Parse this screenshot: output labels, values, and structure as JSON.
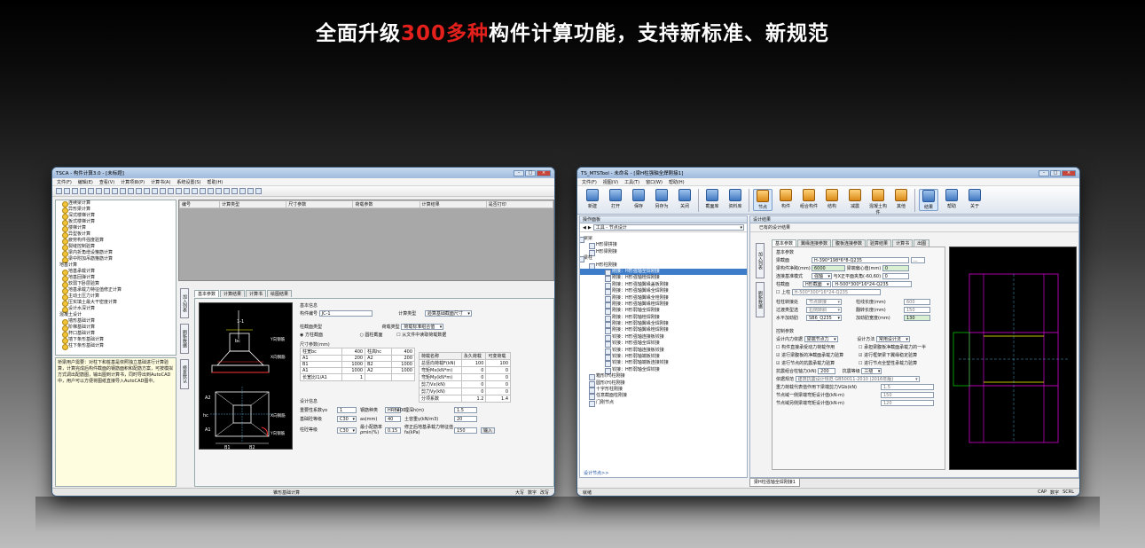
{
  "hero": {
    "pre": "全面升级",
    "highlight": "300多种",
    "post": "构件计算功能，支持新标准、新规范"
  },
  "colors": {
    "highlight": "#e3201b",
    "accent": "#3f77c0"
  },
  "left_window": {
    "title": "TSCA - 构件计算3.0 - [未标题]",
    "window_buttons": [
      "-",
      "□",
      "×"
    ],
    "menu": [
      "文件(F)",
      "编辑(E)",
      "查看(V)",
      "计算项目(P)",
      "计算书(A)",
      "系统设置(S)",
      "帮助(H)"
    ],
    "tree": [
      {
        "text": "连续梁计算",
        "group": false
      },
      {
        "text": "异形梁计算",
        "group": false
      },
      {
        "text": "深式楼梯计算",
        "group": false
      },
      {
        "text": "板式楼梯计算",
        "group": false
      },
      {
        "text": "楼梯计算",
        "group": false
      },
      {
        "text": "异型板计算",
        "group": false
      },
      {
        "text": "疲劳构件强度验算",
        "group": false
      },
      {
        "text": "裂缝控制验算",
        "group": false
      },
      {
        "text": "梁内折角增设箍筋计算",
        "group": false
      },
      {
        "text": "梁中附加吊筋箍筋计算",
        "group": false
      },
      {
        "text": "地基计算",
        "group": true
      },
      {
        "text": "地基承载计算",
        "group": false
      },
      {
        "text": "地基回弹计算",
        "group": false
      },
      {
        "text": "软弱下卧层验算",
        "group": false
      },
      {
        "text": "地基承载力特征值修正计算",
        "group": false
      },
      {
        "text": "主动土压力计算",
        "group": false
      },
      {
        "text": "压实填土最大干密度计算",
        "group": false
      },
      {
        "text": "设计水深计算",
        "group": false
      },
      {
        "text": "混凝土设计",
        "group": true
      },
      {
        "text": "墙形基础计算",
        "group": false
      },
      {
        "text": "阶梯基础计算",
        "group": false
      },
      {
        "text": "杯口基础计算",
        "group": false
      },
      {
        "text": "墙下条形基础计算",
        "group": false
      },
      {
        "text": "柱下条形基础计算",
        "group": false
      }
    ],
    "help_text": "桥梁用户需要：对柱下和桩基是依照独立基础进行计算验算，计算完成后构件截面的钢筋面积和配筋方案，可按模拟方式调出配筋图，输出图到计算书，同时导出到AutoCAD中，用户可以方便将图纸直接导入AutoCAD图中。",
    "result_columns": [
      "编号",
      "计算类型",
      "尺寸参数",
      "荷载参数",
      "计算结果",
      "是否打印"
    ],
    "side_tabs": [
      "加入列表",
      "刷新数据",
      "修复默认"
    ],
    "tabs": [
      "基本参数",
      "计算结果",
      "计算书",
      "绘图结果"
    ],
    "cad_labels": [
      "Y向钢筋",
      "X向钢筋",
      "X向钢筋",
      "Y向钢筋",
      "bc",
      "hc",
      "B1",
      "B2",
      "A1",
      "A2",
      "1-1"
    ],
    "basic_info": {
      "section": "基本信息",
      "id_label": "构件编号",
      "id_value": "JC-1",
      "type_label": "计算类型",
      "type_value": "验算基础截面尺寸"
    },
    "column_type": {
      "label": "柱截面类型",
      "opt1": "方柱截面",
      "opt2": "圆柱截面"
    },
    "load_type": {
      "label": "荷载类型",
      "value": "荷载标准组合值",
      "checkbox": "从文件中读取荷载数据"
    },
    "dim_table": {
      "title": "尺寸参数(mm)",
      "rows": [
        [
          "柱宽bc",
          "400",
          "柱高hc",
          "400"
        ],
        [
          "A1",
          "200",
          "A2",
          "200"
        ],
        [
          "B1",
          "1000",
          "B2",
          "1000"
        ],
        [
          "A1",
          "1000",
          "A2",
          "1000"
        ],
        [
          "长宽比l1/A1",
          "1",
          "",
          ""
        ]
      ]
    },
    "load_table": {
      "headers": [
        "荷载名称",
        "永久荷载",
        "可变荷载"
      ],
      "rows": [
        [
          "总竖向荷载F(kN)",
          "100",
          "100"
        ],
        [
          "弯矩Mx(kN*m)",
          "0",
          "0"
        ],
        [
          "弯矩My(kN*m)",
          "0",
          "0"
        ],
        [
          "剪力Vx(kN)",
          "0",
          "0"
        ],
        [
          "剪力Vy(kN)",
          "0",
          "0"
        ],
        [
          "分项系数",
          "1.2",
          "1.4"
        ]
      ]
    },
    "design": {
      "title": "设计信息",
      "rows": [
        [
          "重要性系数γo",
          "1",
          "钢筋种类",
          "HRB300",
          "埋深h(m)",
          "1.5"
        ],
        [
          "基础砼等级",
          "C30",
          "as(mm)",
          "40",
          "土容重γ(kN/m3)",
          "20"
        ],
        [
          "柱砼等级",
          "C30",
          "最小配筋率ρmin(%)",
          "0.15",
          "修正后地基承载力特征值fa(kPa)",
          "150"
        ]
      ],
      "button": "输入"
    },
    "status": {
      "center": "锥形基础计算",
      "right": [
        "大写",
        "数字",
        "改写"
      ]
    }
  },
  "right_window": {
    "title": "TS_MTSTool - 未命名 - [梁H柱强轴全焊刚接1]",
    "window_buttons": [
      "-",
      "□",
      "×"
    ],
    "menu": [
      "文件(F)",
      "视图(V)",
      "工具(T)",
      "窗口(W)",
      "帮助(H)"
    ],
    "ribbon": [
      {
        "label": "新建",
        "active": false,
        "orange": false
      },
      {
        "label": "打开",
        "active": false,
        "orange": false
      },
      {
        "label": "保存",
        "active": false,
        "orange": false
      },
      {
        "label": "另存为",
        "active": false,
        "orange": false
      },
      {
        "label": "关闭",
        "active": false,
        "orange": false
      },
      {
        "label": "截面库",
        "active": false,
        "orange": false
      },
      {
        "label": "资料库",
        "active": false,
        "orange": false
      },
      {
        "label": "节点",
        "active": true,
        "orange": true
      },
      {
        "label": "构件",
        "active": false,
        "orange": true
      },
      {
        "label": "组合构件",
        "active": false,
        "orange": true
      },
      {
        "label": "结构",
        "active": false,
        "orange": true
      },
      {
        "label": "减震",
        "active": false,
        "orange": true
      },
      {
        "label": "混凝土构件",
        "active": false,
        "orange": true
      },
      {
        "label": "其他",
        "active": false,
        "orange": true
      },
      {
        "label": "结果",
        "active": true,
        "orange": false
      },
      {
        "label": "帮助",
        "active": false,
        "orange": false
      },
      {
        "label": "关于",
        "active": false,
        "orange": false
      }
    ],
    "nav_title": "操作面板",
    "nav_sub": "工具 - 节点设计",
    "tree": [
      {
        "text": "梁梁",
        "level": 0
      },
      {
        "text": "H形梁拼接",
        "level": 1
      },
      {
        "text": "H形梁刚接",
        "level": 1
      },
      {
        "text": "梁柱",
        "level": 0
      },
      {
        "text": "H形柱刚接",
        "level": 1
      },
      {
        "text": "刚接：H形强轴全焊刚接",
        "level": 2
      },
      {
        "text": "刚接：H形强轴栓焊刚接",
        "level": 2
      },
      {
        "text": "刚接：H形强轴翼缘盖板刚接",
        "level": 2
      },
      {
        "text": "刚接：H形强轴翼缘全焊刚接",
        "level": 2
      },
      {
        "text": "刚接：H形强轴翼缘全栓刚接",
        "level": 2
      },
      {
        "text": "刚接：H形强轴翼缘栓焊刚接",
        "level": 2
      },
      {
        "text": "刚接：H形弱轴全焊刚接",
        "level": 2
      },
      {
        "text": "刚接：H形弱轴栓焊刚接",
        "level": 2
      },
      {
        "text": "刚接：H形弱轴翼缘全焊刚接",
        "level": 2
      },
      {
        "text": "刚接：H形弱轴翼缘栓焊刚接",
        "level": 2
      },
      {
        "text": "铰接：H形强轴连接板铰接",
        "level": 2
      },
      {
        "text": "铰接：H形强轴全焊铰接",
        "level": 2
      },
      {
        "text": "铰接：H形弱轴连接板铰接",
        "level": 2
      },
      {
        "text": "铰接：H形弱轴端板铰接",
        "level": 2
      },
      {
        "text": "铰接：H形弱轴端板连接铰接",
        "level": 2
      },
      {
        "text": "铰接：H形弱轴全焊铰接",
        "level": 2
      },
      {
        "text": "箱形(H)柱刚接",
        "level": 1
      },
      {
        "text": "圆形(H)柱刚接",
        "level": 1
      },
      {
        "text": "十字形柱刚接",
        "level": 1
      },
      {
        "text": "任意截面柱刚接",
        "level": 1
      },
      {
        "text": "门刚节点",
        "level": 1
      }
    ],
    "nav_footer": "设计节点>>",
    "design_title": "设计结果",
    "design_sub": "已有的设计结果",
    "side_tabs": [
      "加入列表",
      "刷新数据"
    ],
    "tabs": [
      "基本参数",
      "翼缘连接参数",
      "腹板连接参数",
      "验算结果",
      "计算书",
      "出图"
    ],
    "basic_title": "基本参数",
    "beam_section": {
      "label": "梁截面",
      "value": "H-390*198*6*8-Q235"
    },
    "beam_len": {
      "label": "梁构件净跨(mm)",
      "value": "6000",
      "label2": "梁端偏心值(mm)",
      "value2": "0"
    },
    "conn_mode": {
      "label": "连接基准模式",
      "value": "强轴",
      "label2": "与X正平面夹角(-60,60)",
      "value2": "0"
    },
    "col_section": {
      "label": "柱截面",
      "value": "H形截面",
      "value2": "H-500*300*16*24-Q235"
    },
    "upper_col": {
      "label": "上柱",
      "value": "H-500*300*16*24-Q235"
    },
    "rows2": [
      {
        "l1": "柱柱转接处",
        "v1": "节点转接",
        "l2": "柱线长度(mm)",
        "v2": "600"
      },
      {
        "l1": "过渡类型选",
        "v1": "右侧转斜",
        "l2": "翻转长度(mm)",
        "v2": "150"
      },
      {
        "l1": "水平加劲肋",
        "v1": "SB6_Q235",
        "l2": "加劲肋宽度(mm)",
        "v2": "130"
      }
    ],
    "control_title": "控制参数",
    "control": {
      "force_label": "设计内力依据",
      "force_value": "梁端节点力",
      "method_label": "设计方法",
      "method_value": "常用设计法",
      "checks": [
        {
          "text": "构件直接承受动力荷载作用",
          "checked": false
        },
        {
          "text": "承担梁腹板净截面承载力的一半",
          "checked": false
        },
        {
          "text": "进行梁腹板的净截面承载力验算",
          "checked": true
        },
        {
          "text": "进行框架梁下翼缘稳定验算",
          "checked": true
        },
        {
          "text": "进行节点的抗震承载力验算",
          "checked": true
        },
        {
          "text": "进行节点全塑性承载力验算",
          "checked": false
        }
      ],
      "shear_label": "抗震组合柱轴力(kN)",
      "shear_value": "200",
      "grade_label": "抗震等级",
      "grade_value": "三级",
      "spec_label": "依据规范",
      "spec_value": "建筑抗震设计规范 GB50011-2010 (2016年版)",
      "r1_label": "重力荷载代表值作用下梁端剪力VGb(kN)",
      "r1_value": "1.5",
      "r2_label": "节点域一侧梁端弯矩设计值(kN·m)",
      "r2_value": "150",
      "r3_label": "节点域另侧梁端弯矩设计值(kN·m)",
      "r3_value": "120"
    },
    "bottom_tab": "梁H柱强轴全焊刚接1",
    "status": {
      "left": "就绪",
      "right": [
        "CAP",
        "数字",
        "SCRL"
      ]
    }
  }
}
